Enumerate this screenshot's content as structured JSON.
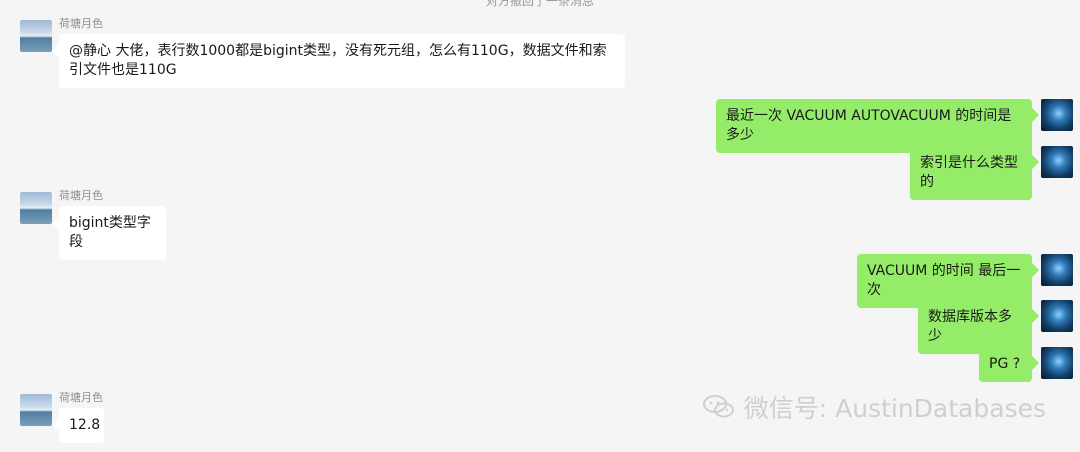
{
  "system": {
    "top_text": "对方撤回了一条消息"
  },
  "chat": {
    "left_sender_name": "荷塘月色",
    "messages": [
      {
        "side": "left",
        "sender": "荷塘月色",
        "text": "@静心 大佬，表行数1000都是bigint类型，没有死元组，怎么有110G，数据文件和索引文件也是110G"
      },
      {
        "side": "right",
        "text": "最近一次 VACUUM AUTOVACUUM 的时间是多少"
      },
      {
        "side": "right",
        "text": "索引是什么类型的"
      },
      {
        "side": "left",
        "sender": "荷塘月色",
        "text": "bigint类型字段"
      },
      {
        "side": "right",
        "text": "VACUUM 的时间 最后一次"
      },
      {
        "side": "right",
        "text": "数据库版本多少"
      },
      {
        "side": "right",
        "text": "PG ?"
      },
      {
        "side": "left",
        "sender": "荷塘月色",
        "text": "12.8"
      }
    ]
  },
  "watermark": {
    "icon": "wechat-logo-icon",
    "text": "微信号: AustinDatabases"
  },
  "colors": {
    "background": "#f5f5f5",
    "left_bubble": "#ffffff",
    "right_bubble": "#95ec69",
    "name_text": "#8e8e8e"
  }
}
